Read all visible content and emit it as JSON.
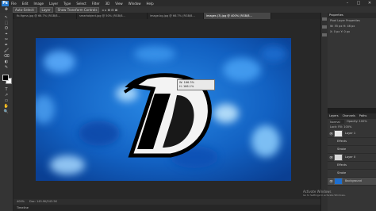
{
  "app": {
    "logo": "Ps"
  },
  "menu": [
    "File",
    "Edit",
    "Image",
    "Layer",
    "Type",
    "Select",
    "Filter",
    "3D",
    "View",
    "Window",
    "Help"
  ],
  "window_controls": {
    "minimize": "–",
    "maximize": "□",
    "close": "✕"
  },
  "options_bar": {
    "auto_select_label": "Auto-Select:",
    "auto_select_value": "Layer",
    "show_transform_label": "Show Transform Controls"
  },
  "tabs": [
    {
      "label": "fb-figma.jpg @ 66.7% (RGB/8...",
      "active": false
    },
    {
      "label": "smartobject.jpg @ 50% (RGB/8...",
      "active": false
    },
    {
      "label": "image-bg.jpg @ 66.7% (RGB/8...",
      "active": false
    },
    {
      "label": "images (3).jpg @ 400% (RGB/8...",
      "active": true
    }
  ],
  "tools": [
    "↖",
    "⬚",
    "ʘ",
    "⌖",
    "✂",
    "✒",
    "🖌",
    "⌫",
    "◐",
    "✎",
    "T",
    "↗",
    "▭",
    "✋",
    "🔍"
  ],
  "transform_tooltip": {
    "w_label": "W:",
    "w_value": "166.3%",
    "h_label": "H:",
    "h_value": "166.1%"
  },
  "status": {
    "zoom": "400%",
    "doc": "Doc: 145.9K/243.5K"
  },
  "timeline_label": "Timeline",
  "properties_panel": {
    "tab": "Properties",
    "kind": "Pixel Layer Properties",
    "w_label": "W:",
    "w_value": "55 px",
    "h_label": "H:",
    "h_value": "46 px",
    "x_label": "X:",
    "x_value": "0 px",
    "y_label": "Y:",
    "y_value": "0 px"
  },
  "layers_panel": {
    "tabs": [
      "Layers",
      "Channels",
      "Paths"
    ],
    "blend_mode": "Normal",
    "opacity_label": "Opacity:",
    "opacity_value": "100%",
    "lock_label": "Lock:",
    "fill_label": "Fill:",
    "fill_value": "100%",
    "layers": [
      {
        "name": "Layer 1",
        "selected": false,
        "thumb_color": "#e8e8e8"
      },
      {
        "name": "fx",
        "selected": false,
        "thumb_color": "#3a3a3a"
      },
      {
        "name": "Effects",
        "selected": false,
        "thumb_color": "#3a3a3a"
      },
      {
        "name": "Stroke",
        "selected": false,
        "thumb_color": "#3a3a3a"
      },
      {
        "name": "Layer 0",
        "selected": false,
        "thumb_color": "#d8d8d8"
      },
      {
        "name": "Effects",
        "selected": false,
        "thumb_color": "#3a3a3a"
      },
      {
        "name": "Stroke",
        "selected": false,
        "thumb_color": "#3a3a3a"
      },
      {
        "name": "Background",
        "selected": true,
        "thumb_color": "#1e6fd0"
      }
    ]
  },
  "watermark": {
    "line1": "Activate Windows",
    "line2": "Go to Settings to activate Windows."
  },
  "colors": {
    "canvas_bg": "#1565c8",
    "accent": "#2a7fd4"
  }
}
